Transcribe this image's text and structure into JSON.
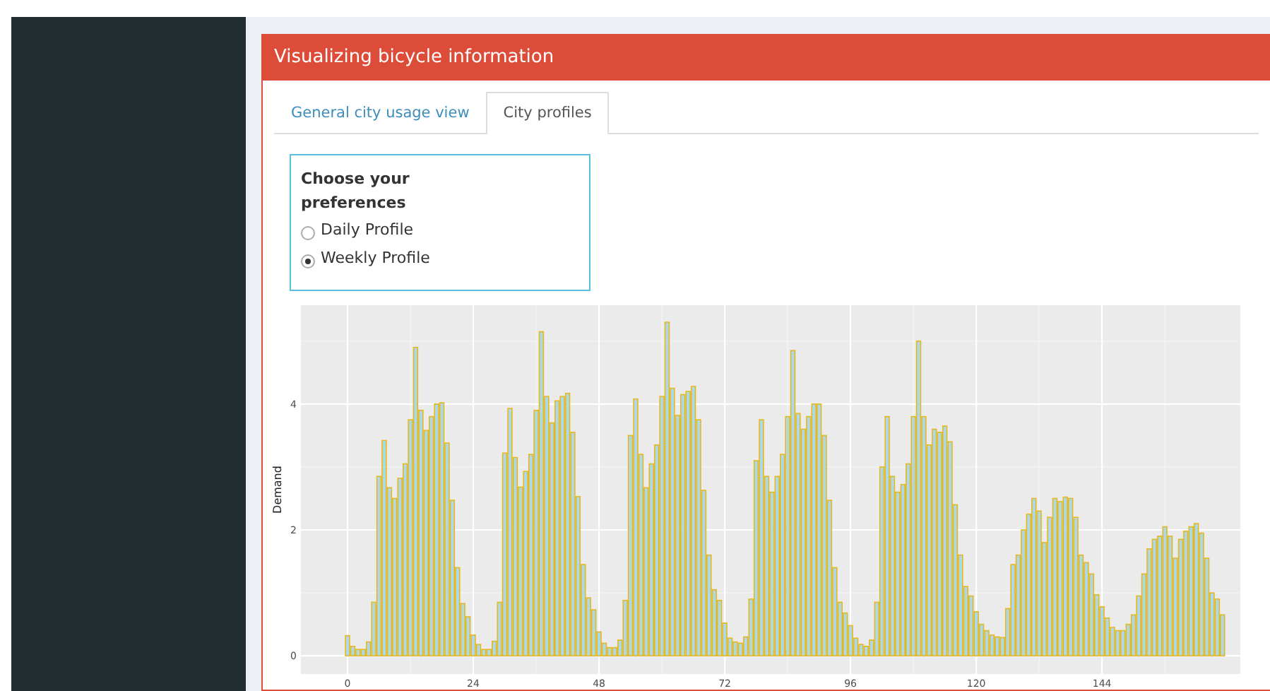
{
  "box": {
    "title": "Visualizing bicycle information"
  },
  "tabs": [
    {
      "label": "General city usage view",
      "selected": false
    },
    {
      "label": "City profiles",
      "selected": true
    }
  ],
  "preferences": {
    "title": "Choose your preferences",
    "options": [
      {
        "label": "Daily Profile",
        "selected": false
      },
      {
        "label": "Weekly Profile",
        "selected": true
      }
    ]
  },
  "chart_data": {
    "type": "bar",
    "ylabel": "Demand",
    "grid": true,
    "x": [
      0,
      1,
      2,
      3,
      4,
      5,
      6,
      7,
      8,
      9,
      10,
      11,
      12,
      13,
      14,
      15,
      16,
      17,
      18,
      19,
      20,
      21,
      22,
      23,
      24,
      25,
      26,
      27,
      28,
      29,
      30,
      31,
      32,
      33,
      34,
      35,
      36,
      37,
      38,
      39,
      40,
      41,
      42,
      43,
      44,
      45,
      46,
      47,
      48,
      49,
      50,
      51,
      52,
      53,
      54,
      55,
      56,
      57,
      58,
      59,
      60,
      61,
      62,
      63,
      64,
      65,
      66,
      67,
      68,
      69,
      70,
      71,
      72,
      73,
      74,
      75,
      76,
      77,
      78,
      79,
      80,
      81,
      82,
      83,
      84,
      85,
      86,
      87,
      88,
      89,
      90,
      91,
      92,
      93,
      94,
      95,
      96,
      97,
      98,
      99,
      100,
      101,
      102,
      103,
      104,
      105,
      106,
      107,
      108,
      109,
      110,
      111,
      112,
      113,
      114,
      115,
      116,
      117,
      118,
      119,
      120,
      121,
      122,
      123,
      124,
      125,
      126,
      127,
      128,
      129,
      130,
      131,
      132,
      133,
      134,
      135,
      136,
      137,
      138,
      139,
      140,
      141,
      142,
      143,
      144,
      145,
      146,
      147,
      148,
      149,
      150,
      151,
      152,
      153,
      154,
      155,
      156,
      157,
      158,
      159,
      160,
      161,
      162,
      163,
      164,
      165,
      166,
      167
    ],
    "xlim": [
      -8.9,
      170.4
    ],
    "ylim": [
      -0.29,
      5.57
    ],
    "xticks": [
      0,
      24,
      48,
      72,
      96,
      120,
      144
    ],
    "yticks": [
      0,
      2,
      4
    ],
    "series": [
      {
        "color": "#add8e6",
        "values": [
          0.32,
          0.15,
          0.1,
          0.1,
          0.22,
          0.85,
          2.85,
          3.42,
          2.67,
          2.5,
          2.82,
          3.05,
          3.75,
          4.9,
          3.9,
          3.58,
          3.8,
          4.0,
          4.02,
          3.38,
          2.47,
          1.4,
          0.83,
          0.62,
          0.33,
          0.18,
          0.1,
          0.1,
          0.23,
          0.85,
          3.22,
          3.93,
          3.15,
          2.68,
          2.93,
          3.2,
          3.9,
          5.15,
          4.12,
          3.7,
          4.05,
          4.12,
          4.17,
          3.55,
          2.53,
          1.45,
          0.92,
          0.73,
          0.38,
          0.2,
          0.13,
          0.13,
          0.25,
          0.88,
          3.5,
          4.08,
          3.2,
          2.67,
          3.05,
          3.35,
          4.12,
          5.3,
          4.25,
          3.82,
          4.15,
          4.2,
          4.28,
          3.75,
          2.63,
          1.6,
          1.05,
          0.88,
          0.52,
          0.28,
          0.22,
          0.2,
          0.3,
          0.9,
          3.1,
          3.75,
          2.85,
          2.6,
          2.85,
          3.2,
          3.8,
          4.85,
          3.85,
          3.6,
          3.8,
          4.0,
          4.0,
          3.5,
          2.47,
          1.4,
          0.85,
          0.68,
          0.48,
          0.28,
          0.18,
          0.15,
          0.25,
          0.85,
          3.0,
          3.8,
          2.85,
          2.6,
          2.72,
          3.05,
          3.8,
          5.0,
          3.8,
          3.35,
          3.6,
          3.55,
          3.65,
          3.4,
          2.4,
          1.6,
          1.1,
          0.95,
          0.7,
          0.5,
          0.4,
          0.33,
          0.3,
          0.29,
          0.75,
          1.45,
          1.6,
          2.0,
          2.25,
          2.5,
          2.3,
          1.8,
          2.2,
          2.5,
          2.45,
          2.52,
          2.5,
          2.2,
          1.6,
          1.48,
          1.3,
          0.97,
          0.78,
          0.6,
          0.45,
          0.4,
          0.4,
          0.5,
          0.65,
          0.95,
          1.3,
          1.7,
          1.85,
          1.9,
          2.05,
          1.9,
          1.55,
          1.85,
          1.98,
          2.05,
          2.1,
          1.95,
          1.55,
          1.0,
          0.9,
          0.65
        ]
      }
    ]
  }
}
